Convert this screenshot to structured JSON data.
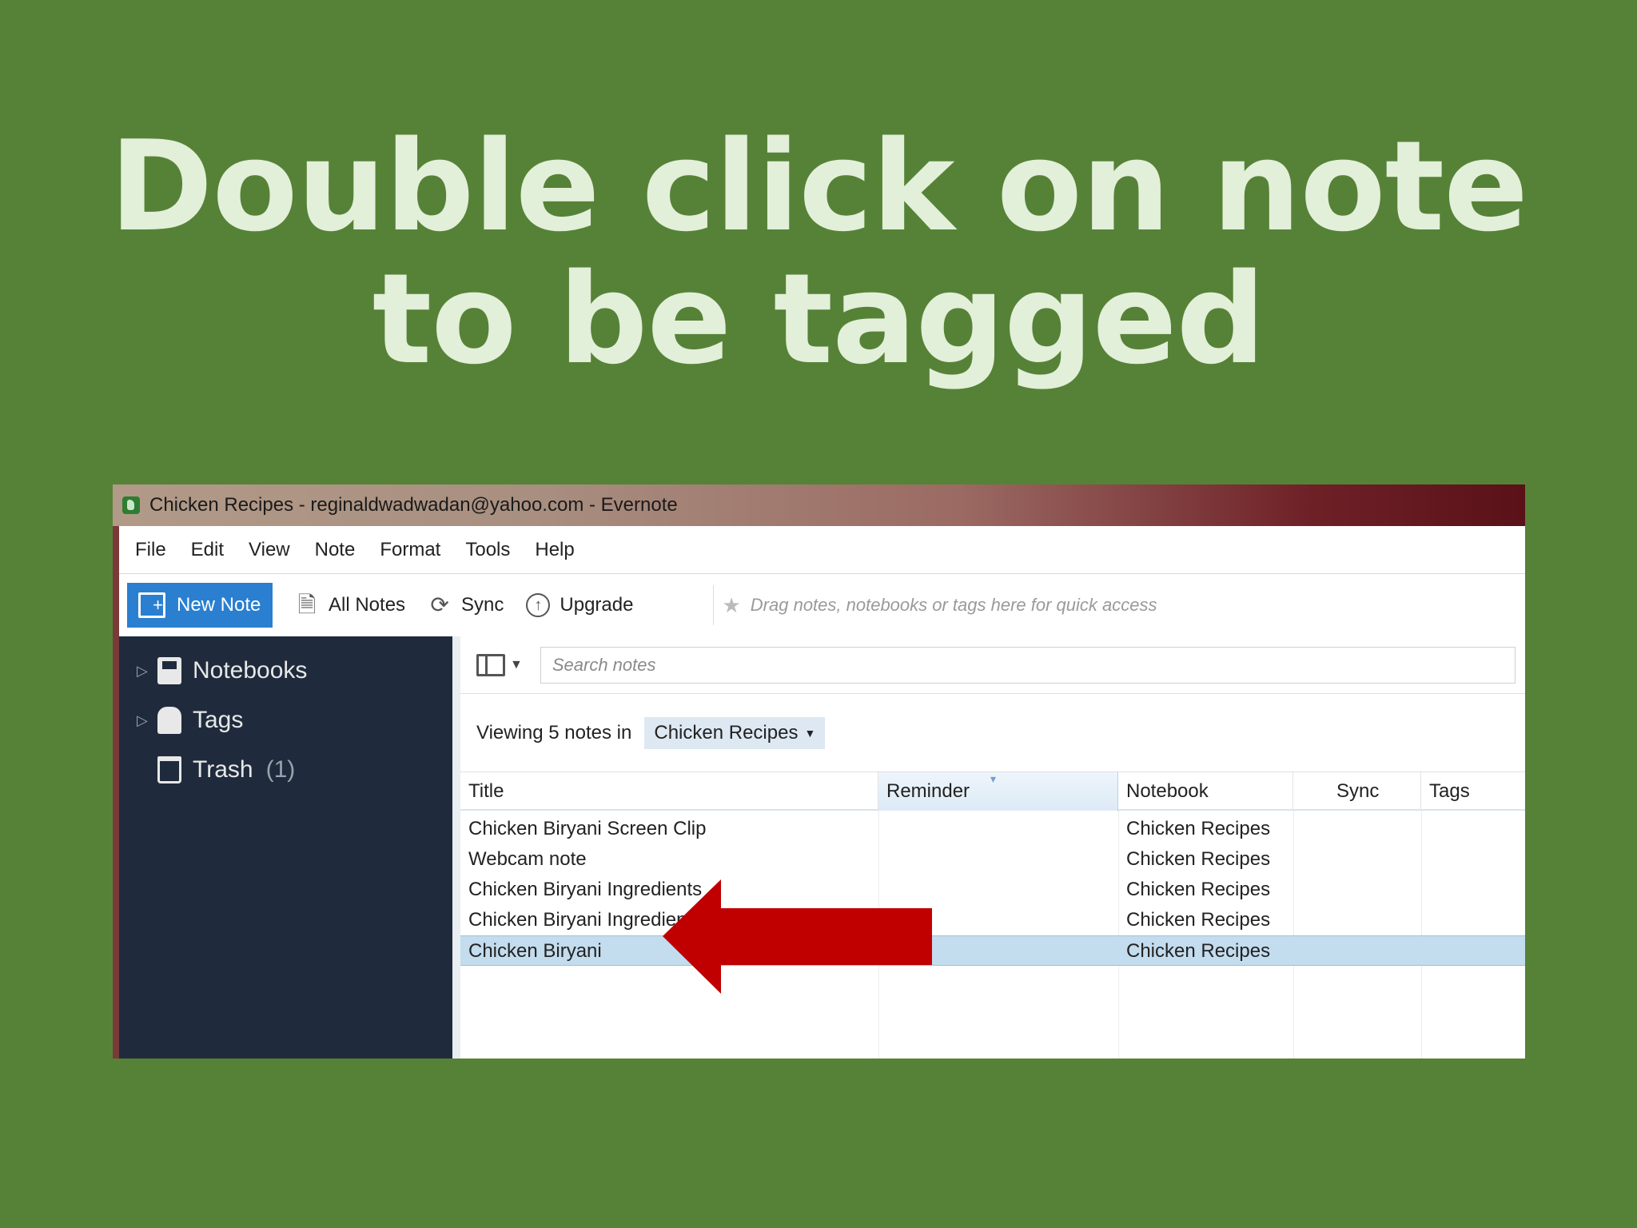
{
  "slide": {
    "title_line1": "Double click on note",
    "title_line2": "to be tagged"
  },
  "window": {
    "title": "Chicken Recipes - reginaldwadwadan@yahoo.com - Evernote"
  },
  "menu": [
    "File",
    "Edit",
    "View",
    "Note",
    "Format",
    "Tools",
    "Help"
  ],
  "toolbar": {
    "new_note": "New Note",
    "all_notes": "All Notes",
    "sync": "Sync",
    "upgrade": "Upgrade",
    "quick_access_hint": "Drag notes, notebooks or tags here for quick access"
  },
  "sidebar": {
    "notebooks": "Notebooks",
    "tags": "Tags",
    "trash": "Trash",
    "trash_count": "(1)"
  },
  "search": {
    "placeholder": "Search notes"
  },
  "viewing": {
    "text": "Viewing 5 notes in",
    "notebook": "Chicken Recipes"
  },
  "table": {
    "columns": [
      "Title",
      "Reminder",
      "Notebook",
      "Sync",
      "Tags"
    ],
    "rows": [
      {
        "title": "Chicken Biryani Screen Clip",
        "notebook": "Chicken Recipes"
      },
      {
        "title": "Webcam note",
        "notebook": "Chicken Recipes"
      },
      {
        "title": "Chicken Biryani Ingredients",
        "notebook": "Chicken Recipes"
      },
      {
        "title": "Chicken Biryani Ingredients",
        "notebook": "Chicken Recipes"
      },
      {
        "title": "Chicken Biryani",
        "notebook": "Chicken Recipes",
        "selected": true
      }
    ]
  },
  "colors": {
    "background": "#568237",
    "title_text": "#e2efd9",
    "accent_blue": "#2a7fd0",
    "sidebar": "#1f2b3c",
    "selection": "#c3dcee",
    "pointer_arrow": "#c00000"
  }
}
